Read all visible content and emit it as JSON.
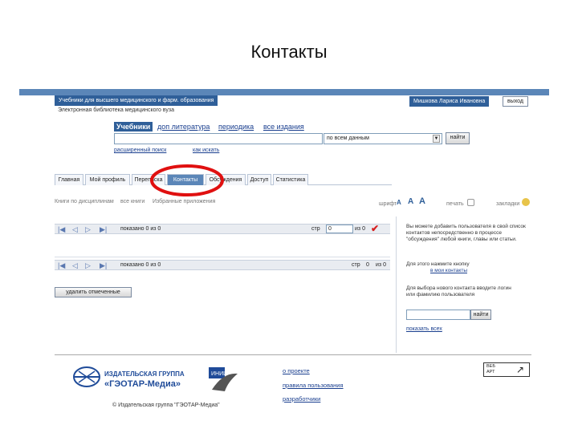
{
  "slide_title": "Контакты",
  "header": {
    "site_title": "Учебники для высшего медицинского и фарм. образования",
    "subtitle": "Электронная библиотека медицинского вуза",
    "user_name": "Мишкова Лариса Ивановна",
    "logout_label": "выход"
  },
  "search": {
    "tabs": [
      "Учебники",
      "доп литература",
      "периодика",
      "все издания"
    ],
    "scope_value": "по всем данным",
    "find_label": "найти",
    "advanced_link": "расширенный поиск",
    "help_link": "как искать"
  },
  "main_tabs": [
    "Главная",
    "Мой профиль",
    "Переписка",
    "Контакты",
    "Обсуждения",
    "Доступ",
    "Статистика"
  ],
  "crumbs": {
    "item1": "Книги по дисциплинам",
    "item2": "все книги",
    "item3": "Избранные приложения"
  },
  "toolbar": {
    "font_label": "шрифт",
    "font_btns": [
      "A",
      "A",
      "A"
    ],
    "print_label": "печать",
    "bookmarks_label": "закладки"
  },
  "pager": {
    "shown_top": "показано 0 из 0",
    "shown_bottom": "показано 0 из 0",
    "page_label": "стр",
    "page_value": "0",
    "of_label": "из 0"
  },
  "remove_selected_label": "удалить отмеченные",
  "side": {
    "info_text": "Вы можете добавить пользователя в свой список контактов непосредственно в процессе \"обсуждения\" любой книги, главы или статьи.",
    "press_text": "Для этого нажмите кнопку",
    "add_contact_link": "в мои контакты",
    "search_user_text": "Для выбора нового контакта вводите логин или фамилию пользователя",
    "find_label": "найти",
    "show_all_link": "показать всех"
  },
  "footer": {
    "publisher_line1": "ИЗДАТЕЛЬСКАЯ ГРУППА",
    "publisher_line2": "«ГЭОТАР-Медиа»",
    "copyright": "© Издательская группа \"ГЭОТАР-Медиа\"",
    "links": [
      "о проекте",
      "правила пользования",
      "разработчики"
    ],
    "badge_line1": "ВЕБ",
    "badge_line2": "АРТ",
    "colors": {
      "accent": "#5b86b8",
      "dark_blue": "#2f5f99",
      "red_highlight": "#e01010"
    }
  }
}
